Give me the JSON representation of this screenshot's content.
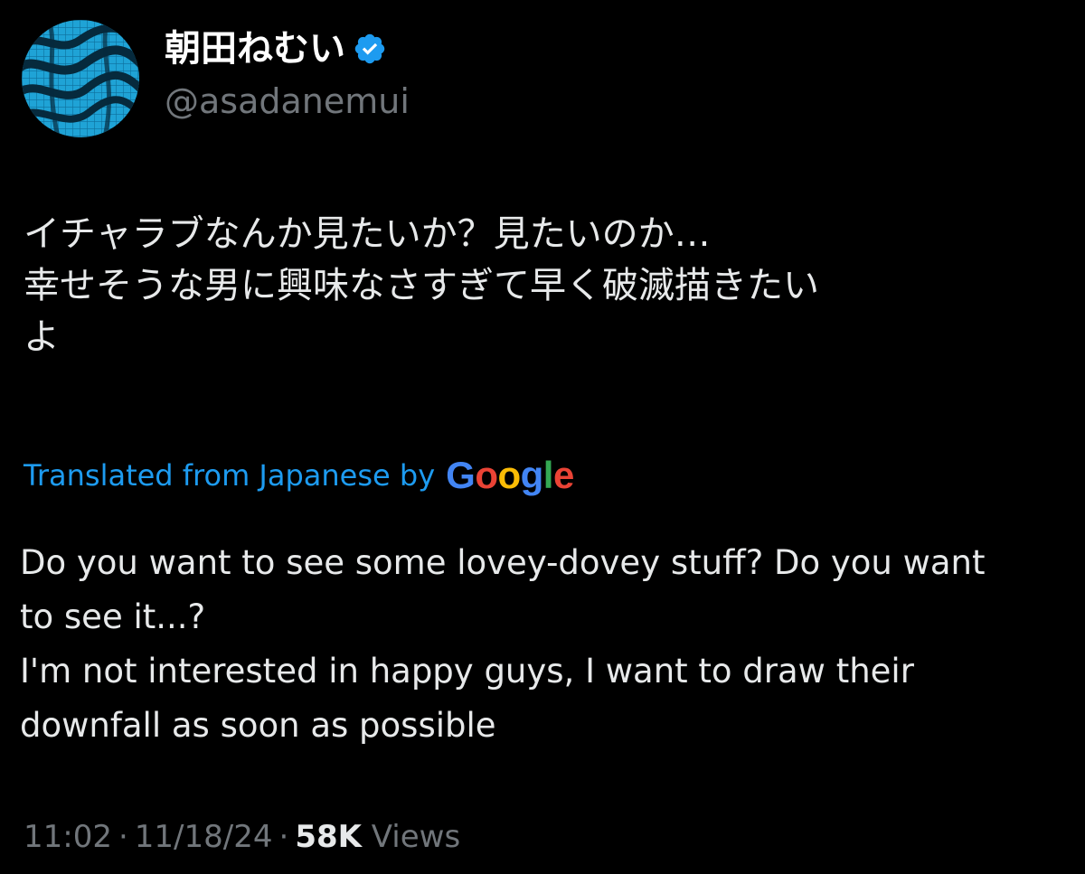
{
  "author": {
    "display_name": "朝田ねむい",
    "handle": "@asadanemui",
    "verified_icon": "verified-badge-icon",
    "avatar_icon": "avatar-wave-pattern"
  },
  "tweet": {
    "text_lines": [
      "イチャラブなんか見たいか？見たいのか…",
      "幸せそうな男に興味なさすぎて早く破滅描きたい",
      "よ"
    ],
    "translation_label": "Translated from Japanese by",
    "translation_provider": {
      "letters": [
        "G",
        "o",
        "o",
        "g",
        "l",
        "e"
      ],
      "colors": [
        "#4285f4",
        "#ea4335",
        "#fbbc05",
        "#4285f4",
        "#34a853",
        "#ea4335"
      ]
    },
    "translated_lines": [
      "Do you want to see some lovey-dovey stuff? Do you want",
      "to see it...?",
      "I'm not interested in happy guys, I want to draw their",
      "downfall as soon as possible"
    ]
  },
  "meta": {
    "time": "11:02",
    "separator": "·",
    "date": "11/18/24",
    "views_count": "58K",
    "views_label": "Views"
  },
  "colors": {
    "background": "#000000",
    "primary_text": "#e7e9ea",
    "secondary_text": "#71767b",
    "link_blue": "#1d9bf0",
    "verified_blue": "#1d9bf0",
    "avatar_cyan": "#1fa3d6"
  }
}
